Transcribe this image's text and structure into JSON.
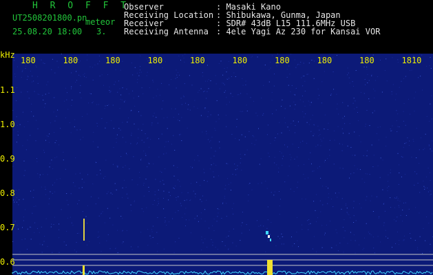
{
  "header": {
    "title": "H R O F F T",
    "filename": "UT2508201800.pn",
    "filename_suffix": "meteor",
    "datetime": "25.08.20 18:00",
    "count": "3.",
    "info": [
      {
        "label": "Observer",
        "value": ": Masaki Kano"
      },
      {
        "label": "Receiving Location",
        "value": ": Shibukawa, Gunma, Japan"
      },
      {
        "label": "Receiver",
        "value": ": SDR# 43dB L15 111.6MHz USB"
      },
      {
        "label": "Receiving Antenna",
        "value": ": 4ele Yagi Az 230 for Kansai VOR"
      }
    ]
  },
  "axis": {
    "unit": "kHz",
    "time_ticks": [
      "180",
      "180",
      "180",
      "180",
      "180",
      "180",
      "180",
      "180",
      "180",
      "1810"
    ],
    "freq_ticks": [
      "1.1",
      "1.0",
      "0.9",
      "0.8",
      "0.7",
      "0.6"
    ]
  },
  "colors": {
    "background": "#000000",
    "spectrogram": "#0c1a78",
    "text_green": "#22c53a",
    "text_white": "#e8e8e8",
    "tick_yellow": "#f0f000",
    "signal_cyan": "#40d8ff"
  }
}
